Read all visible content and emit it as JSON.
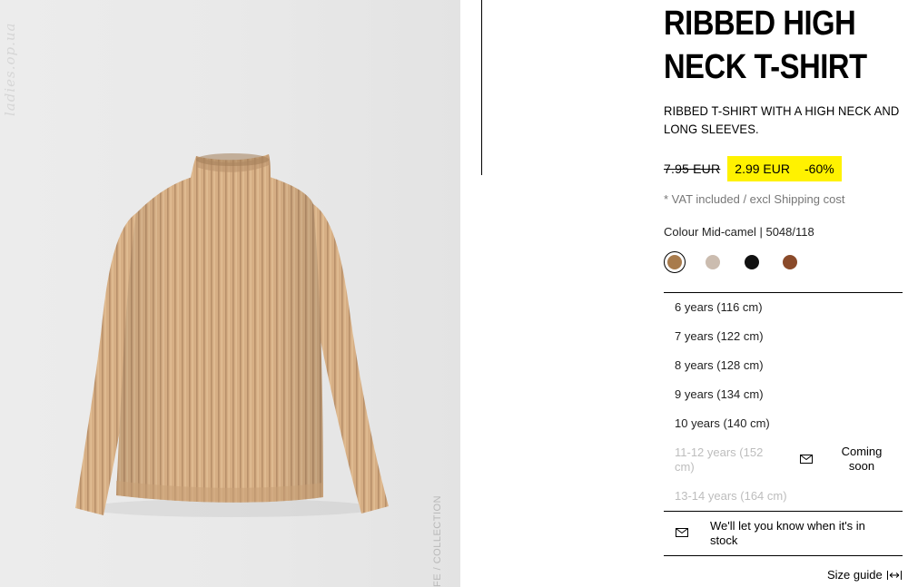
{
  "product": {
    "title_line1": "RIBBED HIGH",
    "title_line2": "NECK T-SHIRT",
    "description_line1": "RIBBED T-SHIRT WITH A HIGH NECK AND",
    "description_line2": "LONG SLEEVES.",
    "old_price": "7.95 EUR",
    "sale_price": "2.99 EUR",
    "discount": "-60%",
    "vat_note": "* VAT included / excl Shipping cost",
    "colour_line": "Colour Mid-camel | 5048/118"
  },
  "photo": {
    "watermark": "ladies.op.ua",
    "collection_label": "FE / COLLECTION"
  },
  "colours": [
    {
      "name": "mid-camel",
      "hex": "#a87b4c",
      "selected": true
    },
    {
      "name": "light-beige",
      "hex": "#cbbcaf",
      "selected": false
    },
    {
      "name": "black",
      "hex": "#111111",
      "selected": false
    },
    {
      "name": "brown",
      "hex": "#8a4a2a",
      "selected": false
    }
  ],
  "sizes": [
    {
      "label": "6 years (116 cm)",
      "available": true
    },
    {
      "label": "7 years (122 cm)",
      "available": true
    },
    {
      "label": "8 years (128 cm)",
      "available": true
    },
    {
      "label": "9 years (134 cm)",
      "available": true
    },
    {
      "label": "10 years (140 cm)",
      "available": true
    },
    {
      "label_line1": "11-12 years (152",
      "label_line2": "cm)",
      "available": false,
      "status_line1": "Coming",
      "status_line2": "soon"
    },
    {
      "label": "13-14 years (164 cm)",
      "available": false
    }
  ],
  "notify": {
    "line1": "We'll let you know when it's in",
    "line2": "stock"
  },
  "size_guide": {
    "label": "Size guide",
    "icon": "resize-horizontal-icon"
  },
  "colors": {
    "sale_highlight": "#fff200",
    "disabled_text": "#bdbdbd",
    "garment": "#d6ae84"
  }
}
